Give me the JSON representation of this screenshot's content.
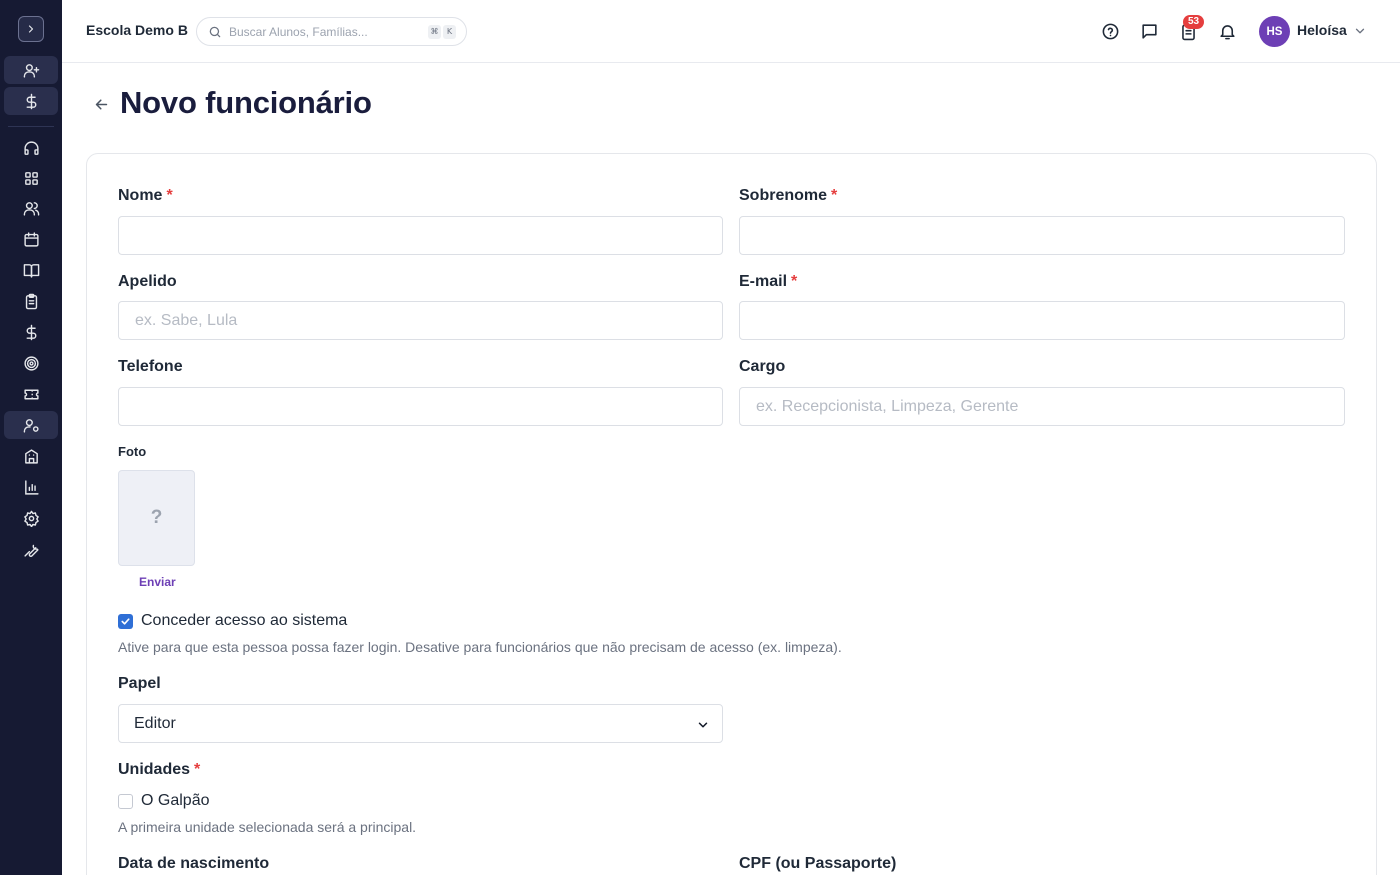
{
  "header": {
    "school_name": "Escola Demo B",
    "search_placeholder": "Buscar Alunos, Famílias...",
    "shortcut_keys": [
      "⌘",
      "K"
    ],
    "tasks_badge": "53",
    "user_initials": "HS",
    "user_name": "Heloísa"
  },
  "sidebar": {
    "items": [
      {
        "icon": "user-plus-icon"
      },
      {
        "icon": "dollar-icon"
      },
      {
        "icon": "headset-icon"
      },
      {
        "icon": "dashboard-icon"
      },
      {
        "icon": "users-icon"
      },
      {
        "icon": "calendar-icon"
      },
      {
        "icon": "book-icon"
      },
      {
        "icon": "clipboard-icon"
      },
      {
        "icon": "dollar-icon"
      },
      {
        "icon": "target-icon"
      },
      {
        "icon": "ticket-icon"
      },
      {
        "icon": "user-settings-icon"
      },
      {
        "icon": "building-icon"
      },
      {
        "icon": "bar-chart-icon"
      },
      {
        "icon": "gear-icon"
      },
      {
        "icon": "wrench-icon"
      }
    ],
    "active_item": "user-settings-icon"
  },
  "page": {
    "title": "Novo funcionário"
  },
  "form": {
    "first_name": {
      "label": "Nome",
      "value": "",
      "required": true
    },
    "last_name": {
      "label": "Sobrenome",
      "value": "",
      "required": true
    },
    "nickname": {
      "label": "Apelido",
      "value": "",
      "placeholder": "ex. Sabe, Lula"
    },
    "email": {
      "label": "E-mail",
      "value": "",
      "required": true
    },
    "phone": {
      "label": "Telefone",
      "value": ""
    },
    "role_title": {
      "label": "Cargo",
      "value": "",
      "placeholder": "ex. Recepcionista, Limpeza, Gerente"
    },
    "photo": {
      "label": "Foto",
      "placeholder_glyph": "?",
      "upload_label": "Enviar"
    },
    "system_access": {
      "label": "Conceder acesso ao sistema",
      "checked": true,
      "help": "Ative para que esta pessoa possa fazer login. Desative para funcionários que não precisam de acesso (ex. limpeza)."
    },
    "permission_role": {
      "label": "Papel",
      "value": "Editor"
    },
    "units": {
      "label": "Unidades",
      "required": true,
      "options": [
        {
          "label": "O Galpão",
          "checked": false
        }
      ],
      "help": "A primeira unidade selecionada será a principal."
    },
    "birth_date": {
      "label": "Data de nascimento"
    },
    "document": {
      "label": "CPF (ou Passaporte)"
    }
  },
  "colors": {
    "sidebar_bg": "#161a33",
    "accent_purple": "#6d3fb5",
    "required_red": "#e53e3e",
    "checkbox_blue": "#2f6fd6",
    "title_navy": "#1a1d3d"
  }
}
